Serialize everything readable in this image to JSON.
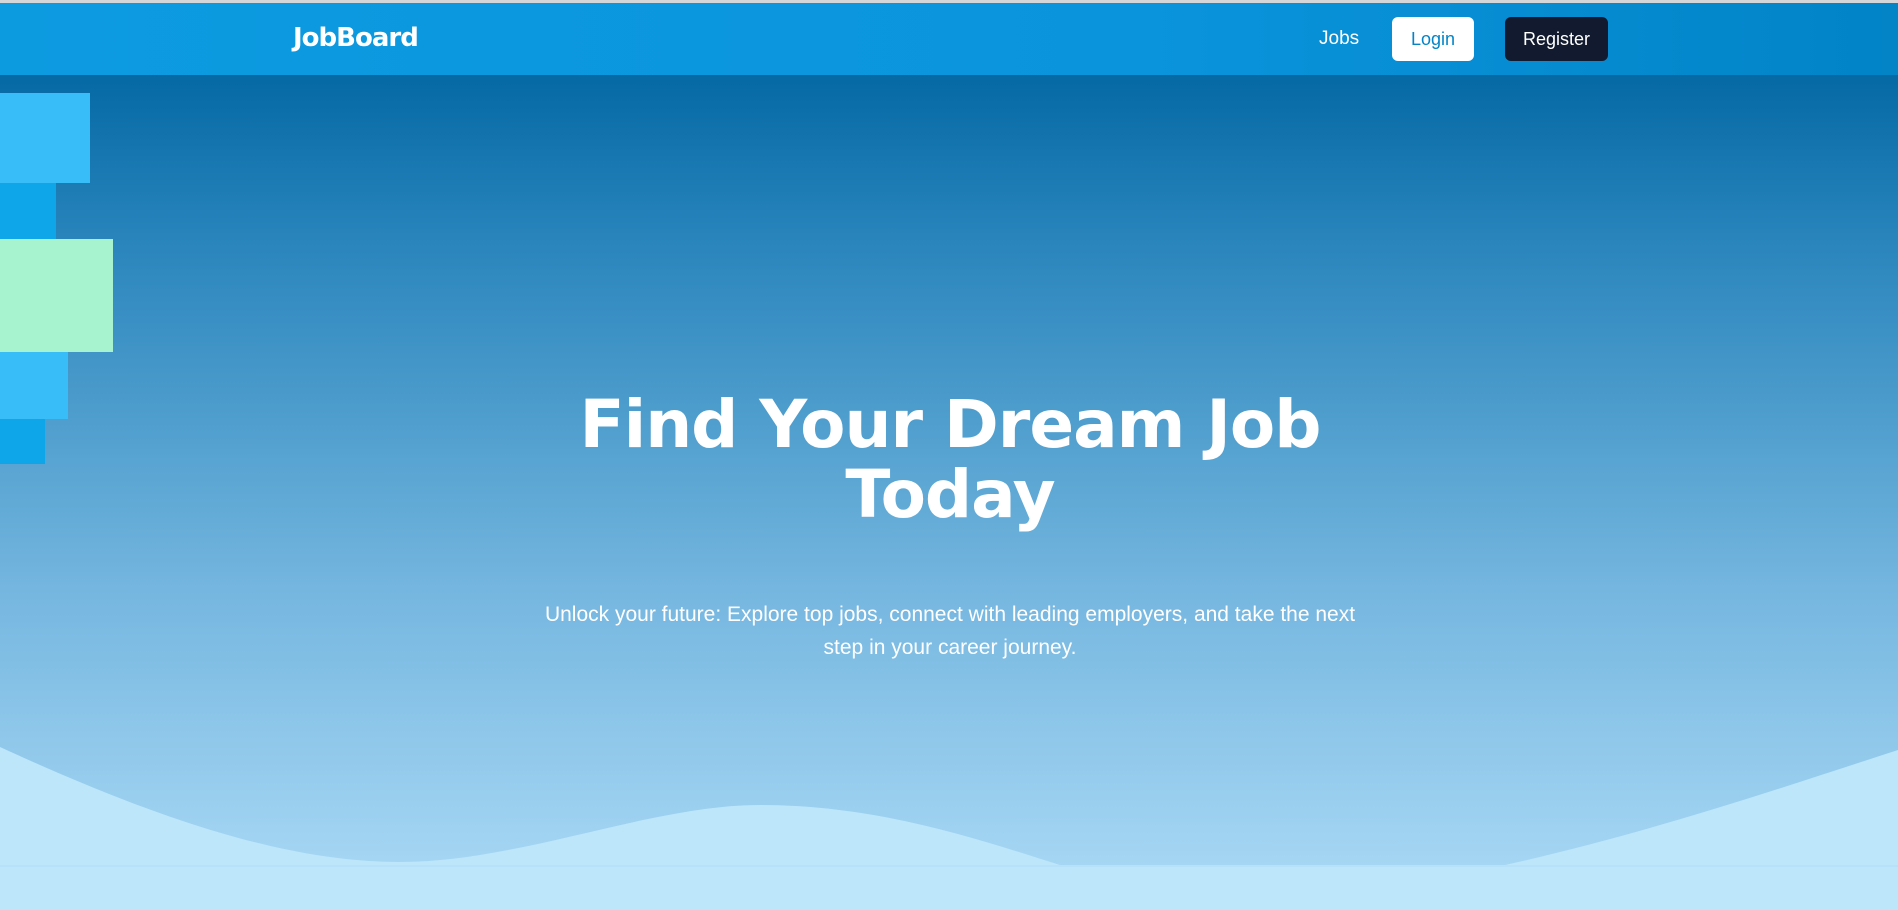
{
  "navbar": {
    "logo": "JobBoard",
    "links": {
      "jobs": "Jobs"
    },
    "buttons": {
      "login": "Login",
      "register": "Register"
    }
  },
  "hero": {
    "title": "Find Your Dream Job Today",
    "subtitle": "Unlock your future: Explore top jobs, connect with leading employers, and take the next step in your career journey."
  },
  "colors": {
    "nav_background": "#0d9be0",
    "hero_top": "#0569a4",
    "hero_bottom": "#a5d6f3",
    "wave": "#bde6fb",
    "login_text": "#0284c7",
    "register_background": "#111a2e",
    "block_sky": "#38bdf8",
    "block_blue": "#0ea5e9",
    "block_mint": "#a7f3d0"
  }
}
